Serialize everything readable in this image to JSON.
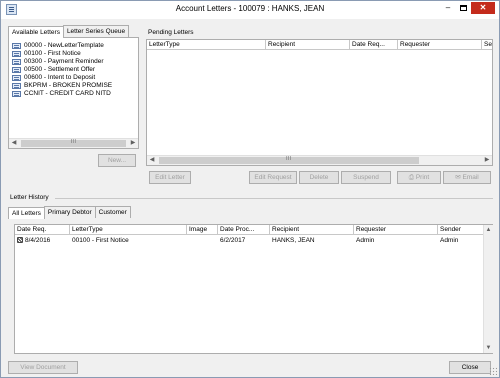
{
  "window": {
    "title": "Account Letters - 100079 : HANKS, JEAN",
    "minimize": "–",
    "close": "✕"
  },
  "left_tabs": [
    "Available Letters",
    "Letter Series Queue"
  ],
  "available_letters": [
    "00000 - NewLetterTemplate",
    "00100 - First Notice",
    "00300 - Payment Reminder",
    "00500 - Settlement Offer",
    "00600 - Intent to Deposit",
    "BKPRM - BROKEN PROMISE",
    "CCNIT - CREDIT CARD NITD"
  ],
  "new_button": "New...",
  "pending": {
    "title": "Pending Letters",
    "columns": [
      "LetterType",
      "Recipient",
      "Date Req...",
      "Requester",
      "Ser"
    ]
  },
  "pending_buttons": {
    "edit_letter": "Edit Letter",
    "edit_request": "Edit Request",
    "delete": "Delete",
    "suspend": "Suspend",
    "print": "Print",
    "email": "Email"
  },
  "history": {
    "title": "Letter History",
    "tabs": [
      "All Letters",
      "Primary Debtor",
      "Customer"
    ],
    "columns": [
      "Date Req.",
      "LetterType",
      "Image",
      "Date Proc...",
      "Recipient",
      "Requester",
      "Sender"
    ],
    "rows": [
      {
        "date_req": "8/4/2016",
        "letter_type": "00100 - First Notice",
        "image": "",
        "date_proc": "6/2/2017",
        "recipient": "HANKS, JEAN",
        "requester": "Admin",
        "sender": "Admin"
      }
    ]
  },
  "scroll_thumb": "III",
  "view_document": "View Document",
  "close": "Close",
  "colors": {
    "close_button": "#c42b1c",
    "border": "#adadad",
    "disabled_text": "#a0a0a0"
  }
}
